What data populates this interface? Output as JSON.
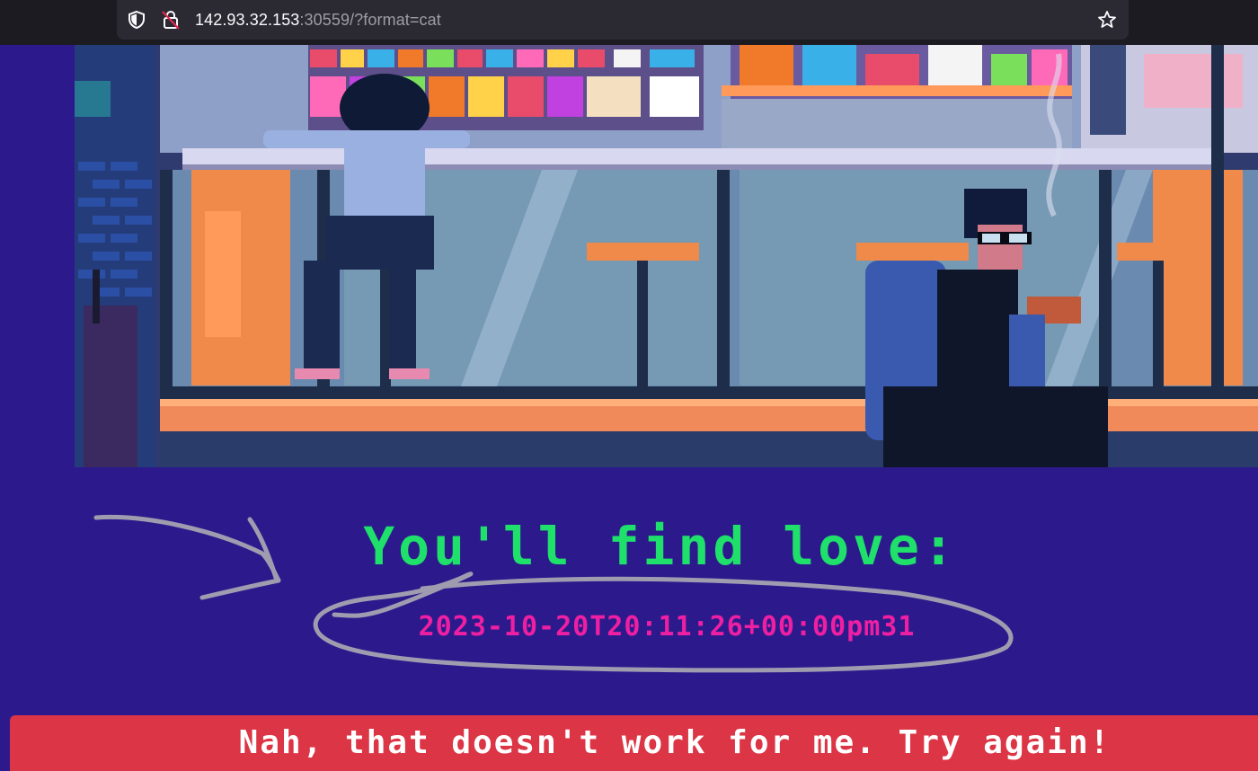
{
  "browser": {
    "url_host": "142.93.32.153",
    "url_rest": ":30559/?format=cat",
    "icons": [
      "shield-icon",
      "insecure-lock-icon",
      "bookmark-star-icon"
    ]
  },
  "hero": {
    "description_icon": "pixel-art-convenience-store-scene"
  },
  "result": {
    "title": "You'll find love:",
    "date": "2023-10-20T20:11:26+00:00pm31"
  },
  "banner": {
    "message": "Nah, that doesn't work for me. Try again!"
  },
  "colors": {
    "page_bg": "#2c1a8c",
    "title": "#1ee06a",
    "date": "#ee1fa3",
    "banner_bg": "#dc3545"
  }
}
